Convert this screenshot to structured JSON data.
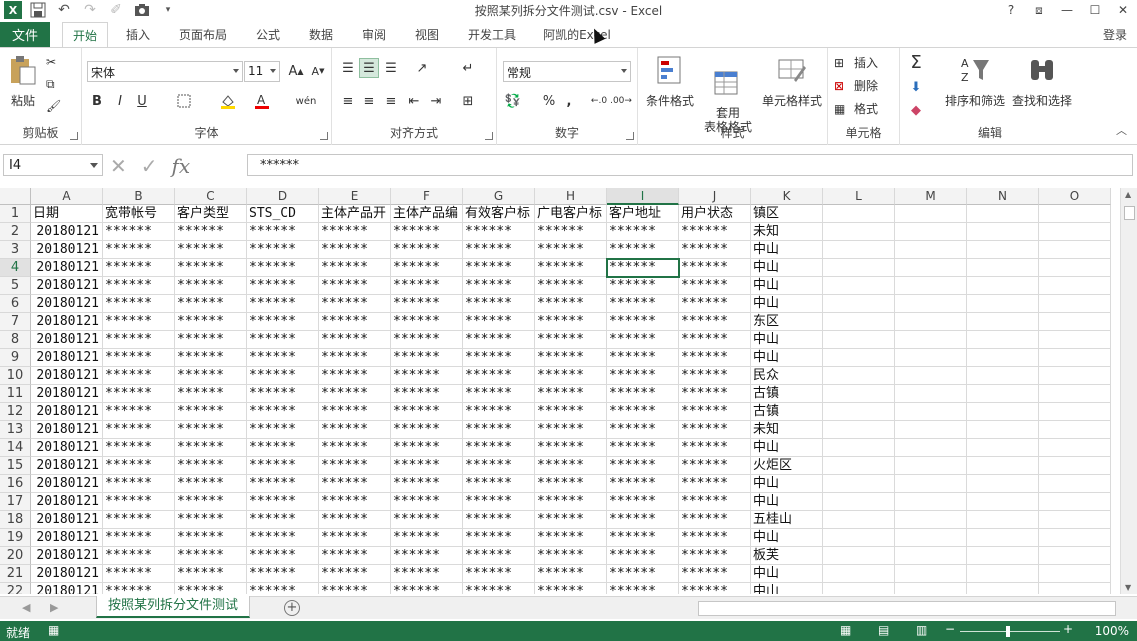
{
  "window": {
    "title": "按照某列拆分文件测试.csv - Excel",
    "controls": [
      "?",
      "⧈",
      "—",
      "☐",
      "✕"
    ]
  },
  "ribbon_tabs": {
    "file": "文件",
    "tabs": [
      {
        "label": "开始",
        "active": true
      },
      {
        "label": "插入"
      },
      {
        "label": "页面布局"
      },
      {
        "label": "公式"
      },
      {
        "label": "数据"
      },
      {
        "label": "审阅"
      },
      {
        "label": "视图"
      },
      {
        "label": "开发工具"
      },
      {
        "label": "阿凯的Excel"
      }
    ],
    "login": "登录"
  },
  "ribbon": {
    "clipboard": {
      "label": "剪贴板",
      "paste": "粘贴"
    },
    "font": {
      "label": "字体",
      "name": "宋体",
      "size": "11",
      "bold": "B",
      "italic": "I",
      "underline": "U",
      "phonetic": "wén"
    },
    "align": {
      "label": "对齐方式"
    },
    "number": {
      "label": "数字",
      "format": "常规",
      "percent": "%",
      "comma": ","
    },
    "styles": {
      "label": "样式",
      "cond": "条件格式",
      "table": "套用\n表格格式",
      "cell": "单元格样式"
    },
    "cells": {
      "label": "单元格",
      "insert": "插入",
      "delete": "删除",
      "format": "格式"
    },
    "edit": {
      "label": "编辑",
      "sort": "排序和筛选",
      "find": "查找和选择"
    }
  },
  "formula_bar": {
    "name_box": "I4",
    "formula": "******",
    "fx": "fx"
  },
  "sheet": {
    "columns": [
      "A",
      "B",
      "C",
      "D",
      "E",
      "F",
      "G",
      "H",
      "I",
      "J",
      "K",
      "L",
      "M",
      "N",
      "O"
    ],
    "selected_col": "I",
    "selected_row": 4,
    "rows": [
      {
        "n": "1",
        "cells": [
          "日期",
          "宽带帐号",
          "客户类型",
          "STS_CD",
          "主体产品开",
          "主体产品编",
          "有效客户标",
          "广电客户标",
          "客户地址",
          "用户状态",
          "镇区"
        ]
      },
      {
        "n": "2",
        "cells": [
          "20180121",
          "******",
          "******",
          "******",
          "******",
          "******",
          "******",
          "******",
          "******",
          "******",
          "未知"
        ]
      },
      {
        "n": "3",
        "cells": [
          "20180121",
          "******",
          "******",
          "******",
          "******",
          "******",
          "******",
          "******",
          "******",
          "******",
          "中山"
        ]
      },
      {
        "n": "4",
        "cells": [
          "20180121",
          "******",
          "******",
          "******",
          "******",
          "******",
          "******",
          "******",
          "******",
          "******",
          "中山"
        ]
      },
      {
        "n": "5",
        "cells": [
          "20180121",
          "******",
          "******",
          "******",
          "******",
          "******",
          "******",
          "******",
          "******",
          "******",
          "中山"
        ]
      },
      {
        "n": "6",
        "cells": [
          "20180121",
          "******",
          "******",
          "******",
          "******",
          "******",
          "******",
          "******",
          "******",
          "******",
          "中山"
        ]
      },
      {
        "n": "7",
        "cells": [
          "20180121",
          "******",
          "******",
          "******",
          "******",
          "******",
          "******",
          "******",
          "******",
          "******",
          "东区"
        ]
      },
      {
        "n": "8",
        "cells": [
          "20180121",
          "******",
          "******",
          "******",
          "******",
          "******",
          "******",
          "******",
          "******",
          "******",
          "中山"
        ]
      },
      {
        "n": "9",
        "cells": [
          "20180121",
          "******",
          "******",
          "******",
          "******",
          "******",
          "******",
          "******",
          "******",
          "******",
          "中山"
        ]
      },
      {
        "n": "10",
        "cells": [
          "20180121",
          "******",
          "******",
          "******",
          "******",
          "******",
          "******",
          "******",
          "******",
          "******",
          "民众"
        ]
      },
      {
        "n": "11",
        "cells": [
          "20180121",
          "******",
          "******",
          "******",
          "******",
          "******",
          "******",
          "******",
          "******",
          "******",
          "古镇"
        ]
      },
      {
        "n": "12",
        "cells": [
          "20180121",
          "******",
          "******",
          "******",
          "******",
          "******",
          "******",
          "******",
          "******",
          "******",
          "古镇"
        ]
      },
      {
        "n": "13",
        "cells": [
          "20180121",
          "******",
          "******",
          "******",
          "******",
          "******",
          "******",
          "******",
          "******",
          "******",
          "未知"
        ]
      },
      {
        "n": "14",
        "cells": [
          "20180121",
          "******",
          "******",
          "******",
          "******",
          "******",
          "******",
          "******",
          "******",
          "******",
          "中山"
        ]
      },
      {
        "n": "15",
        "cells": [
          "20180121",
          "******",
          "******",
          "******",
          "******",
          "******",
          "******",
          "******",
          "******",
          "******",
          "火炬区"
        ]
      },
      {
        "n": "16",
        "cells": [
          "20180121",
          "******",
          "******",
          "******",
          "******",
          "******",
          "******",
          "******",
          "******",
          "******",
          "中山"
        ]
      },
      {
        "n": "17",
        "cells": [
          "20180121",
          "******",
          "******",
          "******",
          "******",
          "******",
          "******",
          "******",
          "******",
          "******",
          "中山"
        ]
      },
      {
        "n": "18",
        "cells": [
          "20180121",
          "******",
          "******",
          "******",
          "******",
          "******",
          "******",
          "******",
          "******",
          "******",
          "五桂山"
        ]
      },
      {
        "n": "19",
        "cells": [
          "20180121",
          "******",
          "******",
          "******",
          "******",
          "******",
          "******",
          "******",
          "******",
          "******",
          "中山"
        ]
      },
      {
        "n": "20",
        "cells": [
          "20180121",
          "******",
          "******",
          "******",
          "******",
          "******",
          "******",
          "******",
          "******",
          "******",
          "板芙"
        ]
      },
      {
        "n": "21",
        "cells": [
          "20180121",
          "******",
          "******",
          "******",
          "******",
          "******",
          "******",
          "******",
          "******",
          "******",
          "中山"
        ]
      },
      {
        "n": "22",
        "cells": [
          "20180121",
          "******",
          "******",
          "******",
          "******",
          "******",
          "******",
          "******",
          "******",
          "******",
          "中山"
        ]
      }
    ]
  },
  "sheet_tabs": {
    "active": "按照某列拆分文件测试"
  },
  "status": {
    "ready": "就绪",
    "zoom": "100%"
  },
  "colors": {
    "accent": "#217346"
  }
}
